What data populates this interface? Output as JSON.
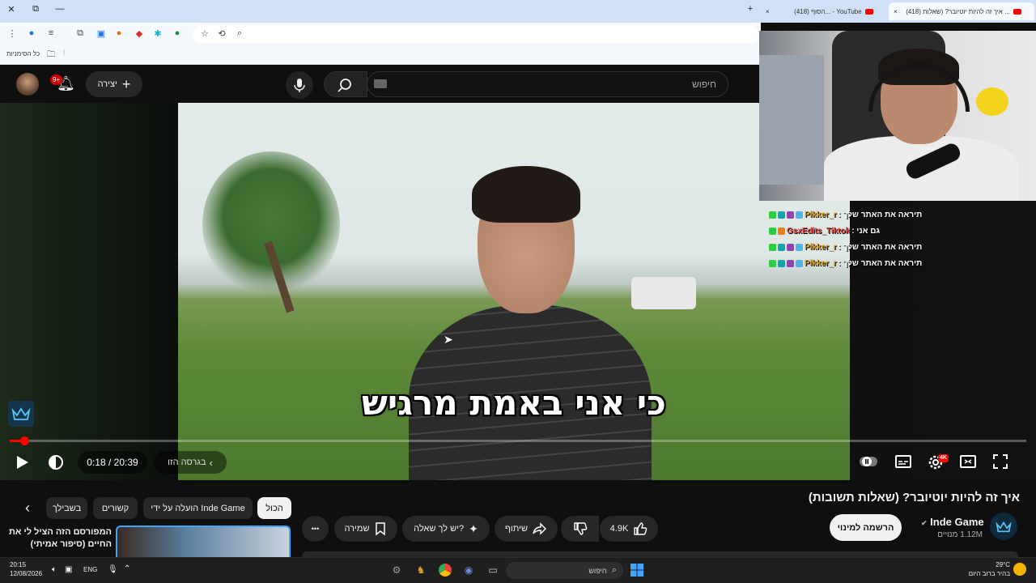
{
  "browser": {
    "tabs": [
      {
        "label": "(418) איך זה להיות יוטיובר? (שאלות ...",
        "active": true
      },
      {
        "label": "(418) הסוף... - YouTube",
        "active": false
      }
    ],
    "new_tab": "+",
    "close_tab": "×",
    "window_controls": {
      "close": "✕",
      "restore": "⧉",
      "minimize": "—"
    },
    "bookmarks_label": "כל הסימניות"
  },
  "youtube_header": {
    "search_placeholder": "חיפוש",
    "create_label": "יצירה",
    "notifications_badge": "9+"
  },
  "video": {
    "subtitle_text": "כי אני באמת מרגיש",
    "current_time": "0:18",
    "duration": "20:39",
    "time_separator": " / ",
    "progress_fraction": 0.0145,
    "version_label": "בגרסה הזו",
    "quality_badge": "4K"
  },
  "chat": [
    {
      "user": "Pikker_r",
      "text": ": תיראה את האתר שלך",
      "color": "#d4a017"
    },
    {
      "user": "GsxEdits_Tiktok",
      "text": ": גם אני",
      "color": "#e0403a"
    },
    {
      "user": "Pikker_r",
      "text": ": תיראה את האתר שלך",
      "color": "#d4a017"
    },
    {
      "user": "Pikker_r",
      "text": ": תיראה את האתר שלך",
      "color": "#d4a017"
    }
  ],
  "watch": {
    "title": "איך זה להיות יוטיובר? (שאלות תשובות)",
    "channel_name": "Inde Game",
    "subscribers": "1.12M מנויים",
    "subscribe_label": "הרשמה למינוי",
    "likes": "4.9K",
    "share_label": "שיתוף",
    "ask_label": "יש לך שאלה?",
    "save_label": "שמירה",
    "more_label": "•••"
  },
  "chips": {
    "all": "הכול",
    "uploaded_by": "הועלה על ידי Inde Game",
    "related": "קשורים",
    "for_you": "בשבילך"
  },
  "recommendation": {
    "title": "המפורסם הזה הציל לי את החיים (סיפור אמיתי)"
  },
  "taskbar": {
    "search_label": "חיפוש",
    "language": "ENG",
    "time": "20:15",
    "date": "12/08/2026",
    "temperature": "29°C",
    "weather_text": "בהיר ברוב היום"
  },
  "colors": {
    "accent_red": "#ff0000",
    "youtube_bg": "#0f0f0f",
    "chip_bg": "#272727",
    "browser_tab_bg": "#cfe0f7"
  }
}
